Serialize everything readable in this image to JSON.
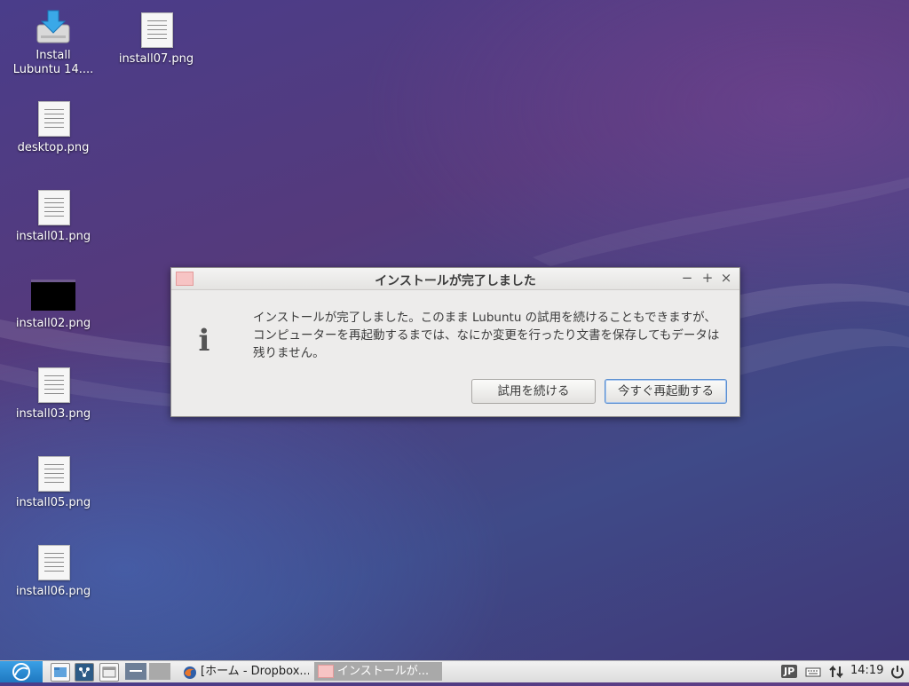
{
  "desktop": {
    "icons": [
      {
        "label": "Install\nLubuntu 14....",
        "icon": "installer-icon"
      },
      {
        "label": "install07.png",
        "icon": "image-file-icon"
      },
      {
        "label": "desktop.png",
        "icon": "image-file-icon"
      },
      {
        "label": "install01.png",
        "icon": "image-file-icon"
      },
      {
        "label": "install02.png",
        "icon": "image-thumbnail-icon"
      },
      {
        "label": "install03.png",
        "icon": "image-file-icon"
      },
      {
        "label": "install05.png",
        "icon": "image-file-icon"
      },
      {
        "label": "install06.png",
        "icon": "image-file-icon"
      }
    ]
  },
  "dialog": {
    "title": "インストールが完了しました",
    "message": "インストールが完了しました。このまま Lubuntu の試用を続けることもできますが、コンピューターを再起動するまでは、なにか変更を行ったり文書を保存してもデータは残りません。",
    "continue_label": "試用を続ける",
    "restart_label": "今すぐ再起動する",
    "minimize": "−",
    "maximize": "+",
    "close": "×"
  },
  "taskbar": {
    "tasks": [
      {
        "label": "[ホーム - Dropbox...",
        "icon": "firefox-icon"
      },
      {
        "label": "インストールが...",
        "icon": "window-icon"
      }
    ],
    "language": "JP",
    "clock": "14:19"
  },
  "colors": {
    "accent": "#5b8fd0",
    "start_button": "#2a8ad6",
    "active_task": "#a9a9a9"
  }
}
